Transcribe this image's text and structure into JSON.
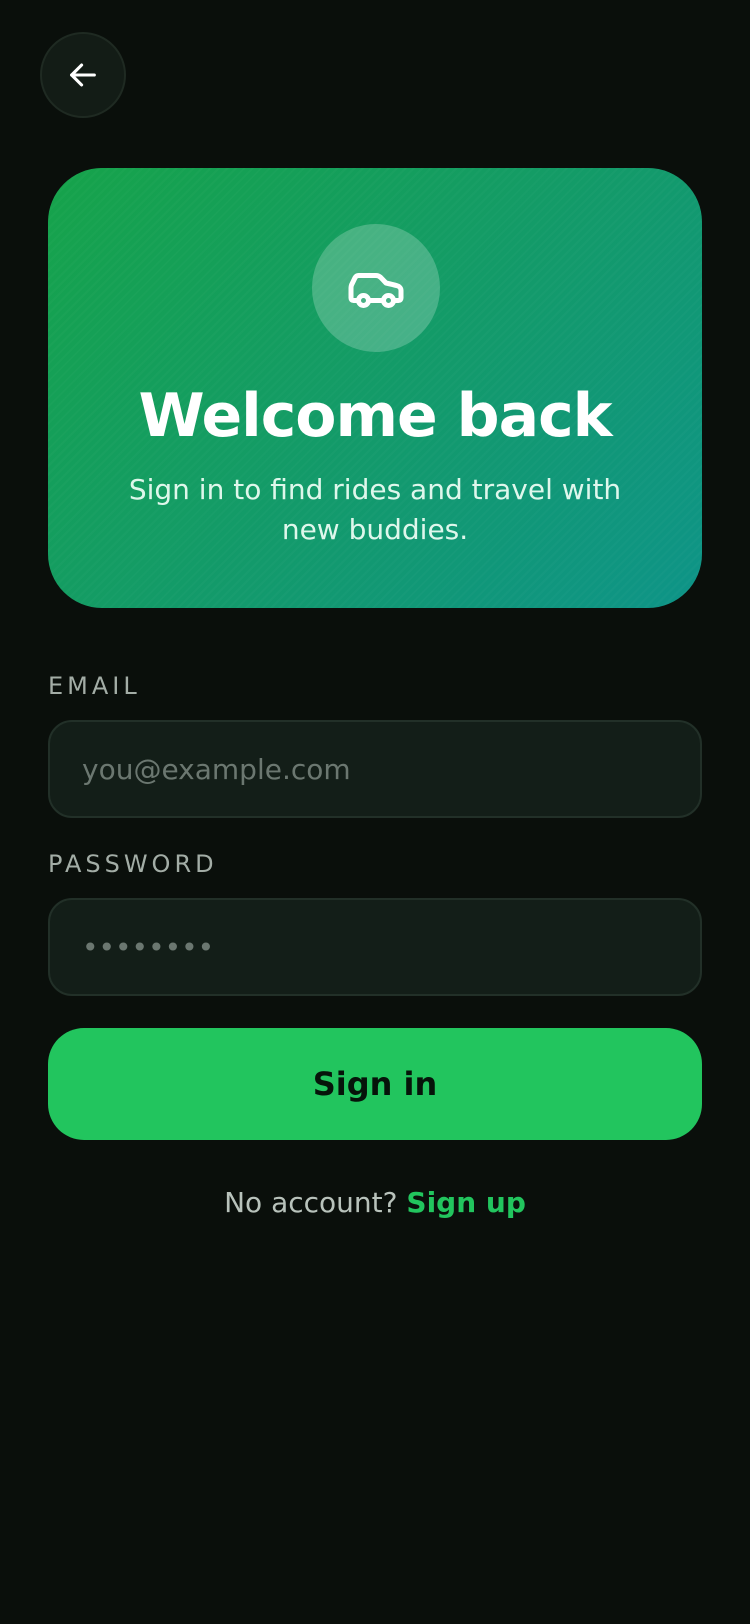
{
  "header": {
    "back_icon": "arrow-left-icon"
  },
  "hero": {
    "icon": "car-icon",
    "title": "Welcome back",
    "subtitle": "Sign in to find rides and travel with new buddies."
  },
  "form": {
    "email_label": "EMAIL",
    "email_placeholder": "you@example.com",
    "email_value": "",
    "password_label": "PASSWORD",
    "password_placeholder": "••••••••",
    "password_value": "",
    "submit_label": "Sign in"
  },
  "footer": {
    "prompt": "No account?",
    "link_label": "Sign up"
  },
  "colors": {
    "background": "#0a0f0b",
    "accent": "#22c55e",
    "hero_gradient_start": "#16a34a",
    "hero_gradient_end": "#0e9488"
  }
}
